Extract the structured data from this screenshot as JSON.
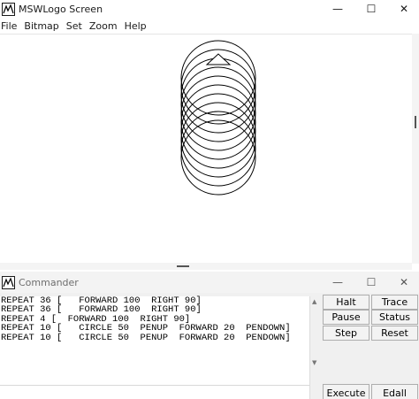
{
  "main_window": {
    "title": "MSWLogo Screen",
    "controls": {
      "minimize": "—",
      "maximize": "☐",
      "close": "✕"
    },
    "menu": [
      "File",
      "Bitmap",
      "Set",
      "Zoom",
      "Help"
    ]
  },
  "drawing": {
    "circle_count": 10,
    "stroke_color": "#000000",
    "turtle": "triangle"
  },
  "commander_window": {
    "title": "Commander",
    "controls": {
      "minimize": "—",
      "maximize": "☐",
      "close": "✕"
    },
    "history": [
      "REPEAT 36 [   FORWARD 100  RIGHT 90]",
      "REPEAT 36 [   FORWARD 100  RIGHT 90]",
      "REPEAT 4 [  FORWARD 100  RIGHT 90]",
      "REPEAT 10 [   CIRCLE 50  PENUP  FORWARD 20  PENDOWN]",
      "REPEAT 10 [   CIRCLE 50  PENUP  FORWARD 20  PENDOWN]"
    ],
    "input_value": "",
    "buttons": {
      "halt": "Halt",
      "trace": "Trace",
      "pause": "Pause",
      "status": "Status",
      "step": "Step",
      "reset": "Reset",
      "execute": "Execute",
      "edall": "Edall"
    }
  },
  "colors": {
    "title_bar_bg": "#ffffff",
    "commander_bg": "#f0f0f0",
    "button_bg": "#f3f3f3",
    "button_border": "#adadad"
  }
}
